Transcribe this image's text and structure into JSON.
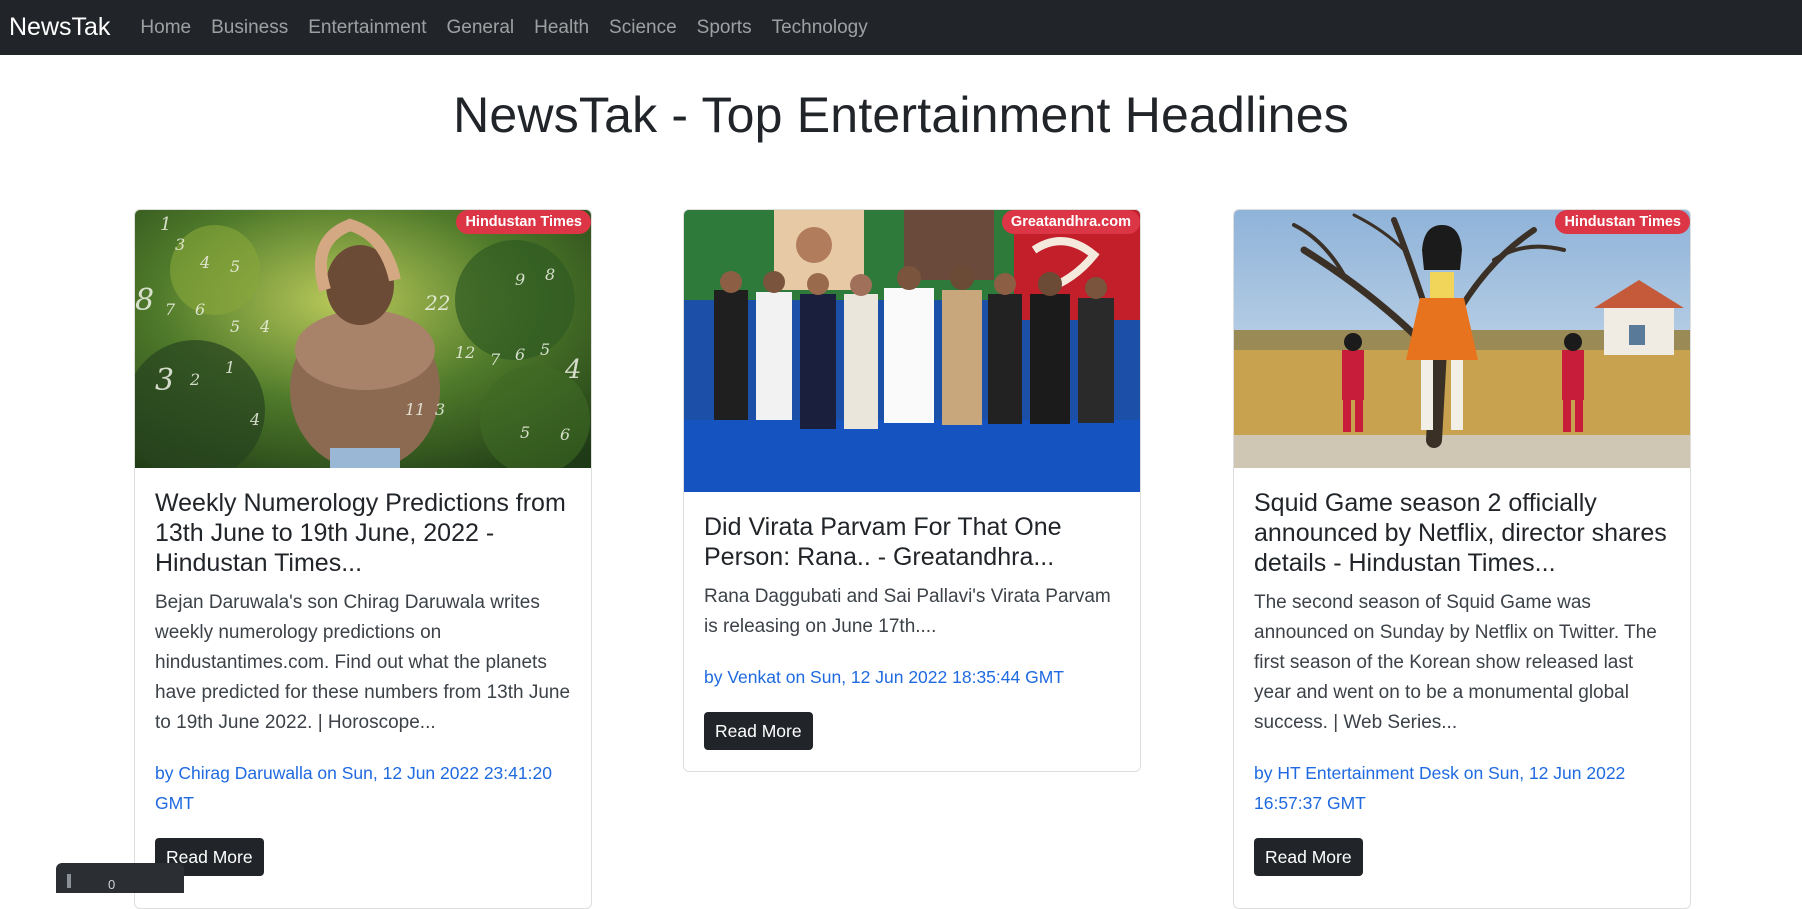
{
  "nav": {
    "brand": "NewsTak",
    "links": [
      "Home",
      "Business",
      "Entertainment",
      "General",
      "Health",
      "Science",
      "Sports",
      "Technology"
    ]
  },
  "page_title": "NewsTak - Top Entertainment Headlines",
  "cards": [
    {
      "source": "Hindustan Times",
      "title": "Weekly Numerology Predictions from 13th June to 19th June, 2022 - Hindustan Times...",
      "description": "Bejan Daruwala's son Chirag Daruwala writes weekly numerology predictions on hindustantimes.com. Find out what the planets have predicted for these numbers from 13th June to 19th June 2022. | Horoscope...",
      "meta": "by Chirag Daruwalla on Sun, 12 Jun 2022 23:41:20 GMT",
      "button": "Read More"
    },
    {
      "source": "Greatandhra.com",
      "title": "Did Virata Parvam For That One Person: Rana.. - Greatandhra...",
      "description": "Rana Daggubati and Sai Pallavi's Virata Parvam is releasing on June 17th....",
      "meta": "by Venkat on Sun, 12 Jun 2022 18:35:44 GMT",
      "button": "Read More"
    },
    {
      "source": "Hindustan Times",
      "title": "Squid Game season 2 officially announced by Netflix, director shares details - Hindustan Times...",
      "description": "The second season of Squid Game was announced on Sunday by Netflix on Twitter. The first season of the Korean show released last year and went on to be a monumental global success. | Web Series...",
      "meta": "by HT Entertainment Desk on Sun, 12 Jun 2022 16:57:37 GMT",
      "button": "Read More"
    }
  ],
  "widget": {
    "value": "0"
  },
  "colors": {
    "navbar": "#212529",
    "badge": "#dc3545",
    "meta_link": "#1f6ae0"
  }
}
